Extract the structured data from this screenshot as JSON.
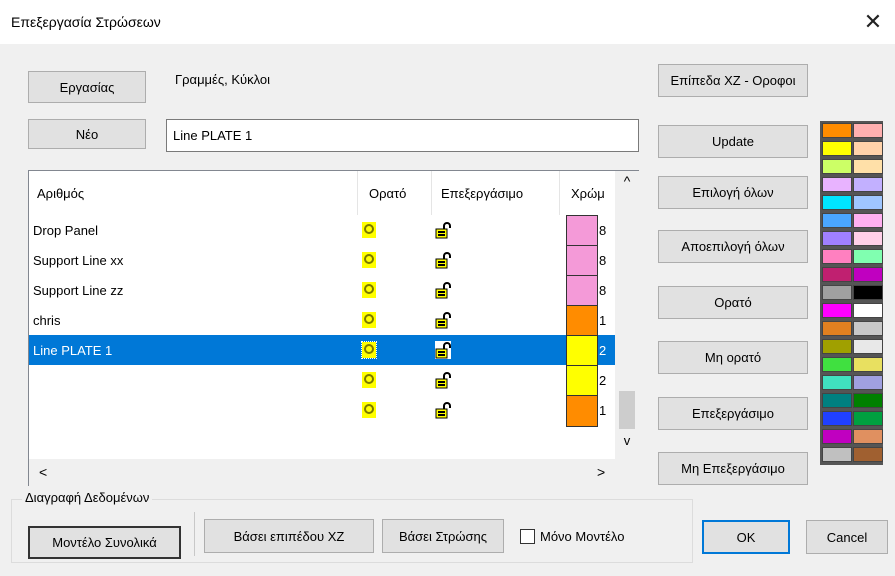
{
  "window": {
    "title": "Επεξεργασία Στρώσεων",
    "close_glyph": "✕"
  },
  "top": {
    "work_button": "Εργασίας",
    "work_label": "Γραμμές, Κύκλοι",
    "new_button": "Νέο",
    "name_value": "Line PLATE 1"
  },
  "list": {
    "columns": [
      "Αριθμός",
      "Ορατό",
      "Επεξεργάσιμο",
      "Χρώμ"
    ],
    "rows": [
      {
        "name": "Drop Panel",
        "color": "#f49ad8",
        "num": "8"
      },
      {
        "name": "Support Line xx",
        "color": "#f49ad8",
        "num": "8"
      },
      {
        "name": "Support Line zz",
        "color": "#f49ad8",
        "num": "8"
      },
      {
        "name": "chris",
        "color": "#ff8c00",
        "num": "1"
      },
      {
        "name": "Line PLATE 1",
        "color": "#ffff00",
        "num": "2",
        "selected": true
      },
      {
        "name": "",
        "color": "#ffff00",
        "num": "2"
      },
      {
        "name": "",
        "color": "#ff8c00",
        "num": "1"
      }
    ],
    "scroll_up": "^",
    "scroll_down": "v",
    "scroll_left": "<",
    "scroll_right": ">"
  },
  "right_buttons": {
    "levels": "Επίπεδα XZ - Οροφοι",
    "update": "Update",
    "select_all": "Επιλογή όλων",
    "deselect_all": "Αποεπιλογή όλων",
    "visible": "Ορατό",
    "not_visible": "Μη ορατό",
    "editable": "Επεξεργάσιμο",
    "not_editable": "Μη Επεξεργάσιμο"
  },
  "palette": [
    [
      "#ff8c00",
      "#ffb0b0"
    ],
    [
      "#ffff00",
      "#ffd2aa"
    ],
    [
      "#ccff66",
      "#ffe0a8"
    ],
    [
      "#e8b3ff",
      "#c2b0ff"
    ],
    [
      "#00e5ff",
      "#9fc6ff"
    ],
    [
      "#4aa6ff",
      "#ffb0f0"
    ],
    [
      "#a080ff",
      "#ffd0e8"
    ],
    [
      "#ff80c0",
      "#80ffb0"
    ],
    [
      "#c02070",
      "#c000c0"
    ],
    [
      "#a0a0a0",
      "#000000"
    ],
    [
      "#ff00ff",
      "#ffffff"
    ],
    [
      "#e08020",
      "#c8c8c8"
    ],
    [
      "#a0a000",
      "#e8e8e8"
    ],
    [
      "#40e040",
      "#e8e060"
    ],
    [
      "#40e0c0",
      "#a0a0e0"
    ],
    [
      "#008080",
      "#008000"
    ],
    [
      "#2040ff",
      "#00a040"
    ],
    [
      "#c000c0",
      "#e09060"
    ],
    [
      "#c0c0c0",
      "#a06030"
    ]
  ],
  "bottom": {
    "group_label": "Διαγραφή Δεδομένων",
    "model_total": "Μοντέλο Συνολικά",
    "by_level": "Βάσει επιπέδου XZ",
    "by_layer": "Βάσει Στρώσης",
    "model_only": "Μόνο Μοντέλο",
    "ok": "OK",
    "cancel": "Cancel"
  }
}
